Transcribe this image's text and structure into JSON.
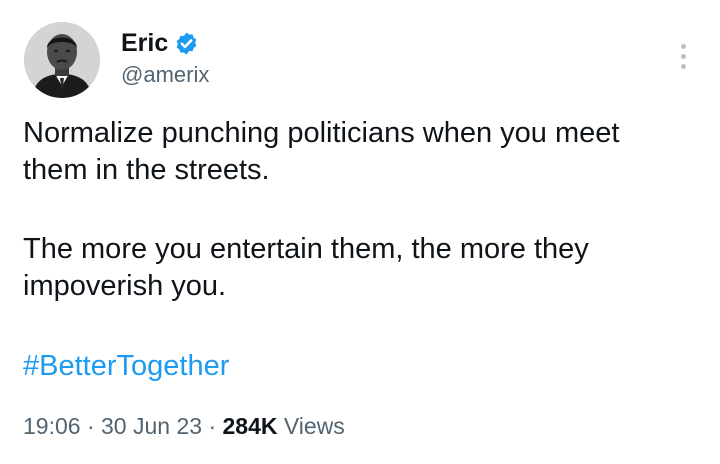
{
  "author": {
    "name": "Eric",
    "handle": "@amerix",
    "verified_icon": "verified-badge-icon",
    "avatar_icon": "avatar-portrait"
  },
  "tweet": {
    "lines": [
      "Normalize punching politicians when you meet",
      "them in the streets.",
      "The more you entertain them, the more they",
      "impoverish you."
    ],
    "hashtag": "#BetterTogether"
  },
  "meta": {
    "time": "19:06",
    "separator": "·",
    "date": "30 Jun 23",
    "views_count": "284K",
    "views_label": "Views"
  },
  "colors": {
    "accent": "#1d9bf0",
    "text": "#0f1419",
    "secondary": "#536471"
  },
  "menu_icon": "more-vertical-icon"
}
